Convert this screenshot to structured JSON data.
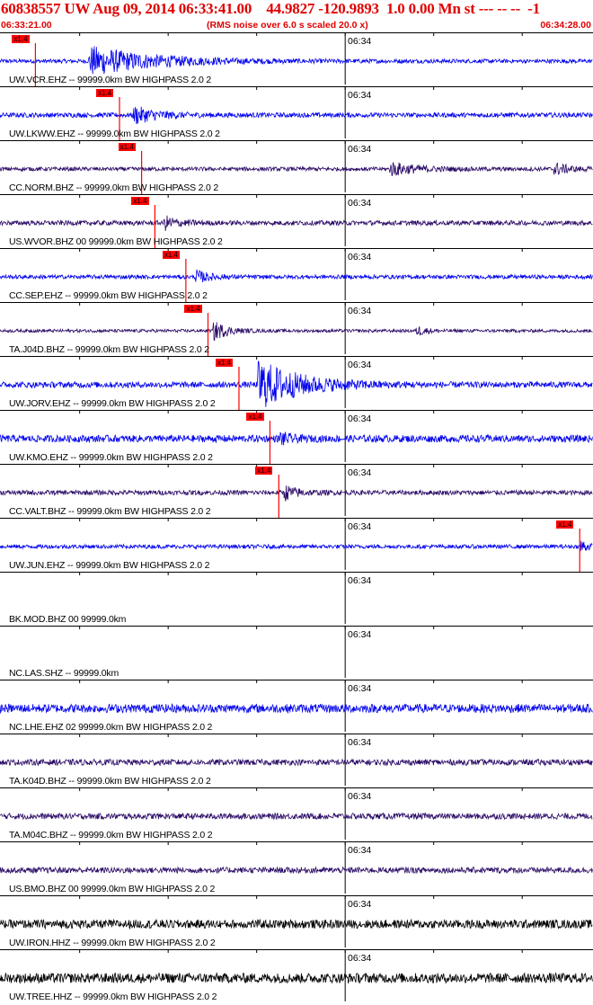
{
  "header": {
    "title": "60838557 UW Aug 09, 2014 06:33:41.00    44.9827 -120.9893  1.0 0.00 Mn st --- -- --  -1",
    "start_time": "06:33:21.00",
    "subtitle": "(RMS noise over 6.0 s scaled 20.0 x)",
    "end_time": "06:34:28.00"
  },
  "colors": {
    "header_text": "#e00000",
    "pick": "#ff0000",
    "trace_blue": "#0000ee",
    "trace_indigo": "#2a0a66",
    "trace_black": "#000000"
  },
  "chart_data": {
    "type": "line",
    "title": "60838557 UW Aug 09, 2014 06:33:41.00",
    "x_range": [
      "06:33:21.00",
      "06:34:28.00"
    ],
    "x_tick_label": "06:34",
    "channels": [
      {
        "label": "UW.VCR.EHZ -- 99999.0km BW  HIGHPASS  2.0  2",
        "pick": "x1.4",
        "pick_time": "06:33:25.0",
        "color": "#0000ee",
        "noise": 0.1,
        "bursts": [
          {
            "t": "06:33:31.0",
            "dur": 14,
            "amp": 0.75
          }
        ]
      },
      {
        "label": "UW.LKWW.EHZ -- 99999.0km BW  HIGHPASS  2.0  2",
        "pick": "x1.4",
        "pick_time": "06:33:34.5",
        "color": "#0000ee",
        "noise": 0.12,
        "bursts": [
          {
            "t": "06:33:36.0",
            "dur": 5,
            "amp": 0.45
          }
        ]
      },
      {
        "label": "CC.NORM.BHZ -- 99999.0km BW  HIGHPASS  2.0  2",
        "pick": "x1.4",
        "pick_time": "06:33:37.0",
        "color": "#2a0a66",
        "noise": 0.1,
        "bursts": [
          {
            "t": "06:34:05.0",
            "dur": 6,
            "amp": 0.35
          },
          {
            "t": "06:34:23.5",
            "dur": 3,
            "amp": 0.35
          }
        ]
      },
      {
        "label": "US.WVOR.BHZ 00 99999.0km BW  HIGHPASS  2.0  2",
        "pick": "x1.4",
        "pick_time": "06:33:38.5",
        "color": "#2a0a66",
        "noise": 0.12,
        "bursts": [
          {
            "t": "06:33:39.5",
            "dur": 3,
            "amp": 0.35
          }
        ]
      },
      {
        "label": "CC.SEP.EHZ -- 99999.0km BW  HIGHPASS  2.0  2",
        "pick": "x1.4",
        "pick_time": "06:33:42.0",
        "color": "#0000ee",
        "noise": 0.1,
        "bursts": [
          {
            "t": "06:33:43.0",
            "dur": 3,
            "amp": 0.35
          }
        ]
      },
      {
        "label": "TA.J04D.BHZ -- 99999.0km BW  HIGHPASS  2.0  2",
        "pick": "x1.4",
        "pick_time": "06:33:44.5",
        "color": "#2a0a66",
        "noise": 0.08,
        "bursts": [
          {
            "t": "06:33:45.0",
            "dur": 3,
            "amp": 0.55
          },
          {
            "t": "06:34:08.0",
            "dur": 2,
            "amp": 0.3
          }
        ]
      },
      {
        "label": "UW.JORV.EHZ -- 99999.0km BW  HIGHPASS  2.0  2",
        "pick": "x1.4",
        "pick_time": "06:33:48.0",
        "color": "#0000ee",
        "noise": 0.15,
        "bursts": [
          {
            "t": "06:33:50.0",
            "dur": 9,
            "amp": 1.3
          }
        ]
      },
      {
        "label": "UW.KMO.EHZ -- 99999.0km BW  HIGHPASS  2.0  2",
        "pick": "x1.4",
        "pick_time": "06:33:51.5",
        "color": "#0000ee",
        "noise": 0.18,
        "bursts": [
          {
            "t": "06:33:52.5",
            "dur": 2,
            "amp": 0.35
          }
        ]
      },
      {
        "label": "CC.VALT.BHZ -- 99999.0km BW  HIGHPASS  2.0  2",
        "pick": "x1.4",
        "pick_time": "06:33:52.5",
        "color": "#2a0a66",
        "noise": 0.12,
        "bursts": [
          {
            "t": "06:33:53.0",
            "dur": 3,
            "amp": 0.4
          }
        ]
      },
      {
        "label": "UW.JUN.EHZ -- 99999.0km BW  HIGHPASS  2.0  2",
        "pick": "x1.4",
        "pick_time": "06:34:26.5",
        "color": "#0000ee",
        "noise": 0.1,
        "bursts": [
          {
            "t": "06:34:26.5",
            "dur": 1.2,
            "amp": 0.55
          }
        ]
      },
      {
        "label": "BK.MOD.BHZ 00 99999.0km",
        "pick": "",
        "pick_time": "",
        "color": "#000000",
        "noise": 0,
        "bursts": []
      },
      {
        "label": "NC.LAS.SHZ -- 99999.0km",
        "pick": "",
        "pick_time": "",
        "color": "#000000",
        "noise": 0,
        "bursts": []
      },
      {
        "label": "NC.LHE.EHZ 02 99999.0km BW  HIGHPASS  2.0  2",
        "pick": "",
        "pick_time": "",
        "color": "#0000ee",
        "noise": 0.22,
        "bursts": []
      },
      {
        "label": "TA.K04D.BHZ -- 99999.0km BW  HIGHPASS  2.0  2",
        "pick": "",
        "pick_time": "",
        "color": "#2a0a66",
        "noise": 0.15,
        "bursts": []
      },
      {
        "label": "TA.M04C.BHZ -- 99999.0km BW  HIGHPASS  2.0  2",
        "pick": "",
        "pick_time": "",
        "color": "#2a0a66",
        "noise": 0.15,
        "bursts": []
      },
      {
        "label": "US.BMO.BHZ 00 99999.0km BW  HIGHPASS  2.0  2",
        "pick": "",
        "pick_time": "",
        "color": "#2a0a66",
        "noise": 0.15,
        "bursts": []
      },
      {
        "label": "UW.IRON.HHZ -- 99999.0km BW  HIGHPASS  2.0  2",
        "pick": "",
        "pick_time": "",
        "color": "#000000",
        "noise": 0.22,
        "bursts": []
      },
      {
        "label": "UW.TREE.HHZ -- 99999.0km BW  HIGHPASS  2.0  2",
        "pick": "",
        "pick_time": "",
        "color": "#000000",
        "noise": 0.25,
        "bursts": []
      }
    ]
  }
}
